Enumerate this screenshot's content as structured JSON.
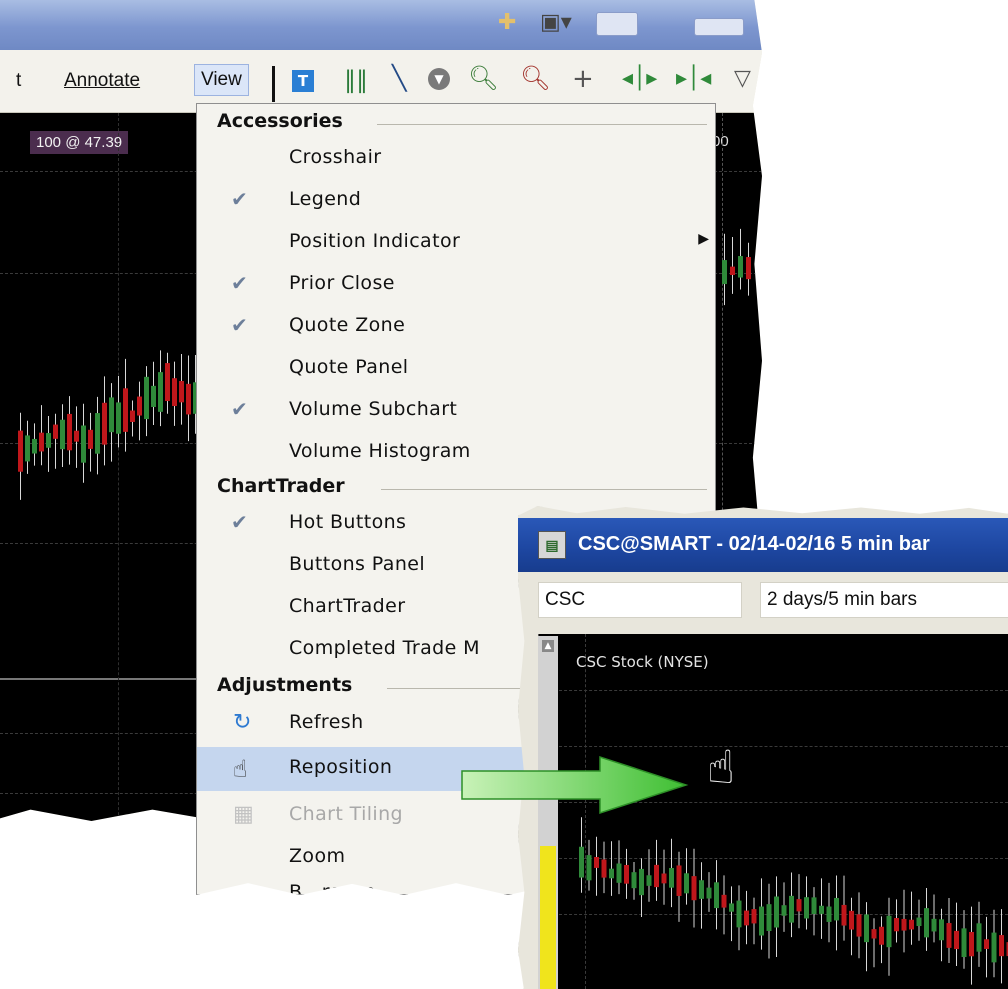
{
  "menubar": {
    "partial_item": "t",
    "items": [
      {
        "label": "Annotate"
      },
      {
        "label": "View",
        "active": true
      }
    ]
  },
  "toolbar_icons": [
    "text-tool-icon",
    "bar-chart-icon",
    "draw-line-icon",
    "down-circle-icon",
    "zoom-in-icon",
    "zoom-out-icon",
    "crosshair-icon",
    "expand-horizontal-icon",
    "split-horizontal-icon",
    "more-dropdown-icon"
  ],
  "chart": {
    "price_tag": "100 @ 47.39",
    "right_label": "00"
  },
  "view_menu": {
    "sections": [
      {
        "heading": "Accessories",
        "items": [
          {
            "label": "Crosshair",
            "checked": false
          },
          {
            "label": "Legend",
            "checked": true
          },
          {
            "label": "Position Indicator",
            "checked": false,
            "submenu": true
          },
          {
            "label": "Prior Close",
            "checked": true
          },
          {
            "label": "Quote Zone",
            "checked": true
          },
          {
            "label": "Quote Panel",
            "checked": false
          },
          {
            "label": "Volume Subchart",
            "checked": true
          },
          {
            "label": "Volume Histogram",
            "checked": false
          }
        ]
      },
      {
        "heading": "ChartTrader",
        "items": [
          {
            "label": "Hot Buttons",
            "checked": true
          },
          {
            "label": "Buttons Panel",
            "checked": false
          },
          {
            "label": "ChartTrader",
            "checked": false
          },
          {
            "label": "Completed Trade M",
            "checked": false
          }
        ]
      },
      {
        "heading": "Adjustments",
        "items": [
          {
            "label": "Refresh",
            "icon": "refresh-icon"
          },
          {
            "label": "Reposition",
            "icon": "hand-pointer-icon",
            "highlighted": true
          },
          {
            "label": "Chart Tiling",
            "icon": "tile-grid-icon",
            "disabled": true
          },
          {
            "label": "Zoom"
          },
          {
            "label": "B...reese"
          }
        ]
      }
    ]
  },
  "secondary_window": {
    "title": "CSC@SMART - 02/14-02/16 5 min bar",
    "symbol": "CSC",
    "period": "2 days/5 min bars",
    "chart_label": "CSC Stock (NYSE)",
    "title_bar_color": "#1d46a0"
  },
  "colors": {
    "up_bar": "#2f8a3a",
    "down_bar": "#c0171b",
    "highlight": "#c5d6ee",
    "arrow": "#5fd24b"
  }
}
